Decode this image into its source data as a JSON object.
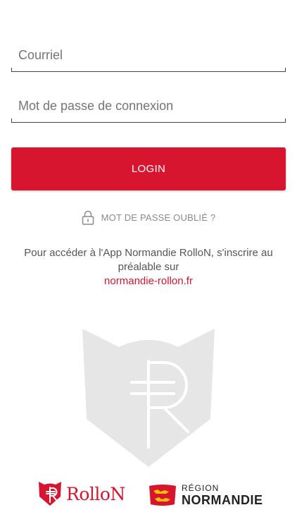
{
  "form": {
    "email_placeholder": "Courriel",
    "password_placeholder": "Mot de passe de connexion",
    "login_label": "LOGIN"
  },
  "forgot": {
    "label": "MOT DE PASSE OUBLIÉ ?",
    "icon": "lock-icon"
  },
  "info": {
    "text": "Pour accéder à l'App Normandie RolloN, s'inscrire au préalable sur",
    "link": "normandie-rollon.fr"
  },
  "footer": {
    "rollon_wordmark": "RolloN",
    "region_small": "RÉGION",
    "region_big": "NORMANDIE"
  },
  "colors": {
    "accent": "#d8152f",
    "muted_text": "#8a8a8a",
    "watermark": "#e6e6e6",
    "region_flag": "#d8152f",
    "region_lions": "#f2c200"
  }
}
